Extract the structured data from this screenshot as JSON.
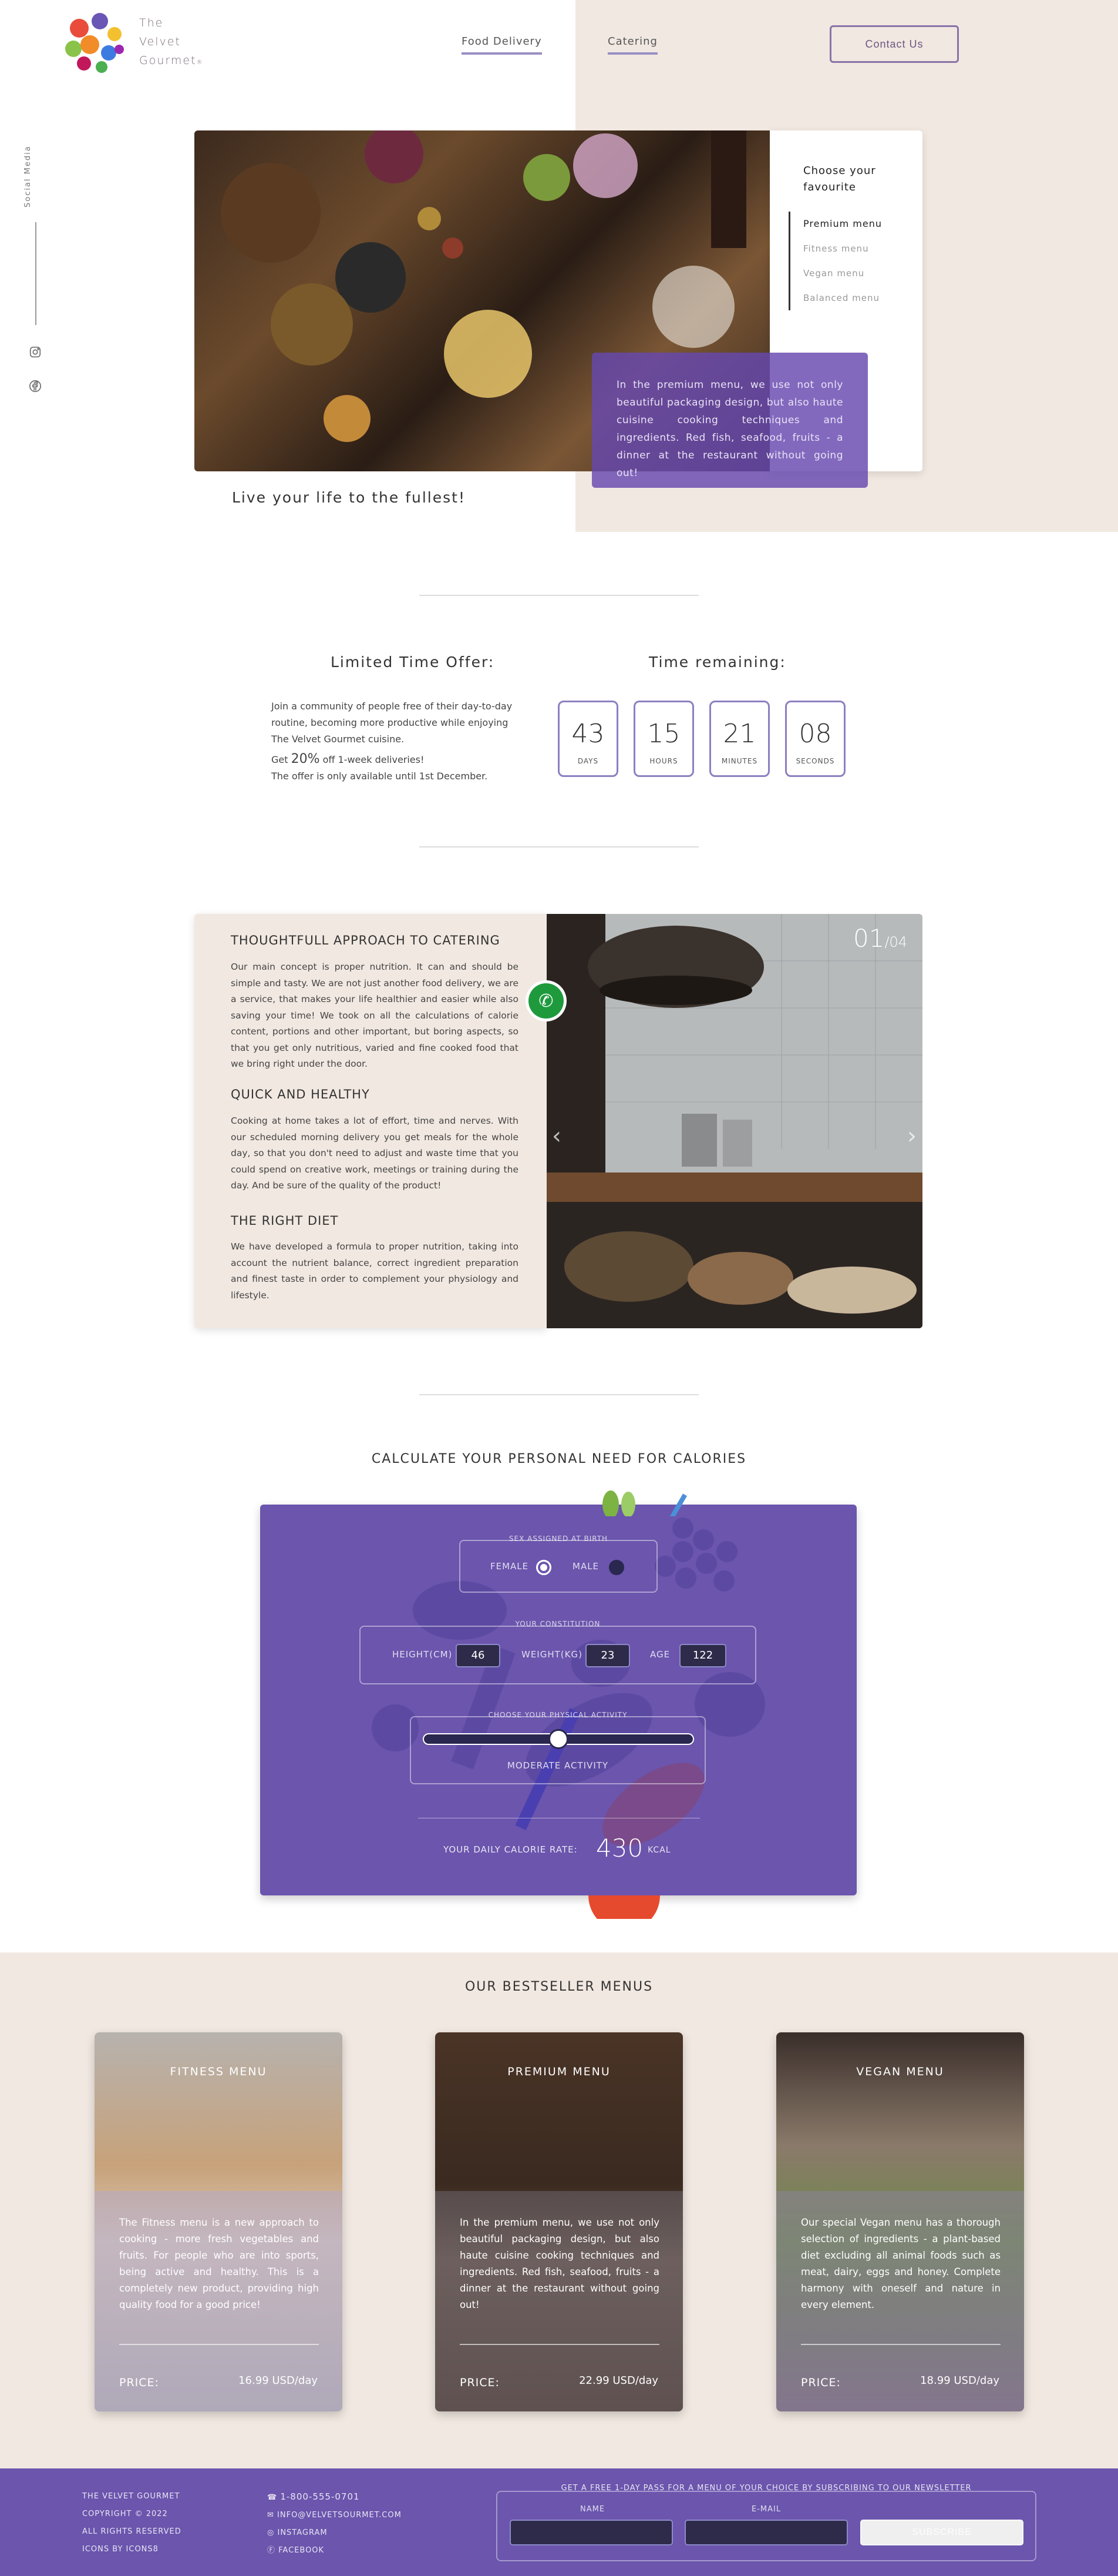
{
  "brand": {
    "name_lines": [
      "The",
      "Velvet",
      "Gourmet"
    ],
    "registered": "®"
  },
  "nav": {
    "links": [
      {
        "label": "Food Delivery"
      },
      {
        "label": "Catering"
      }
    ],
    "contact_label": "Contact Us"
  },
  "social": {
    "label": "Social Media",
    "icons": [
      "instagram-icon",
      "facebook-icon"
    ]
  },
  "hero": {
    "choose_title": "Choose your favourite",
    "menu_items": [
      {
        "label": "Premium menu",
        "active": true
      },
      {
        "label": "Fitness menu",
        "active": false
      },
      {
        "label": "Vegan menu",
        "active": false
      },
      {
        "label": "Balanced menu",
        "active": false
      }
    ],
    "description": "In the premium menu, we use not only beautiful packaging design, but also haute cuisine cooking techniques and ingredients. Red fish, seafood, fruits - a dinner at the restaurant without going out!",
    "tagline": "Live your life to the fullest!"
  },
  "offer": {
    "title": "Limited Time Offer:",
    "text": "Join a community of people free of their day-to-day routine, becoming more productive while enjoying The Velvet Gourmet cuisine.",
    "discount_prefix": "Get ",
    "discount_value": "20%",
    "discount_suffix": " off 1-week deliveries!",
    "availability": "The offer is only available until 1st December.",
    "countdown_title": "Time remaining:",
    "countdown": [
      {
        "value": "43",
        "label": "Days"
      },
      {
        "value": "15",
        "label": "Hours"
      },
      {
        "value": "21",
        "label": "Minutes"
      },
      {
        "value": "08",
        "label": "Seconds"
      }
    ]
  },
  "catering": {
    "sections": [
      {
        "title": "Thoughtfull approach to catering",
        "text": "Our main concept is proper nutrition. It can and should be simple and tasty. We are not just another food delivery, we are a service, that makes your life healthier and easier while also saving your time! We took on all the calculations of calorie content, portions and other important, but boring aspects, so that you get only nutritious, varied and fine cooked food that we bring right under the door."
      },
      {
        "title": "Quick and healthy",
        "text": "Cooking at home takes a lot of effort, time and nerves. With our scheduled morning delivery you get meals for the whole day, so that you don't need to adjust and waste time that you could spend on creative work, meetings or training during the day. And be sure of the quality of the product!"
      },
      {
        "title": "The right diet",
        "text": "We have developed a formula to proper nutrition, taking into account the nutrient balance, correct ingredient preparation and finest taste in order to complement your physiology and lifestyle."
      }
    ],
    "slide_current": "01",
    "slide_total": "/04"
  },
  "calculator": {
    "title": "Calculate your personal need for calories",
    "sex_legend": "Sex assigned at birth",
    "sex_options": [
      {
        "label": "Female",
        "selected": true
      },
      {
        "label": "Male",
        "selected": false
      }
    ],
    "constitution_legend": "Your constitution",
    "height_label": "Height(cm)",
    "height_value": "46",
    "weight_label": "Weight(kg)",
    "weight_value": "23",
    "age_label": "Age",
    "age_value": "122",
    "activity_legend": "Choose your physical activity",
    "activity_level": 0.5,
    "activity_label": "Moderate Activity",
    "rate_label": "Your daily calorie rate:",
    "rate_value": "430",
    "rate_unit": "kcal"
  },
  "bestsellers": {
    "title": "Our bestseller menus",
    "price_label": "Price:",
    "cards": [
      {
        "title": "Fitness menu",
        "text": "The Fitness menu is a new approach to cooking - more fresh vegetables and fruits. For people who are into sports, being active and healthy. This is a completely new product, providing high quality food for a good price!",
        "price": "16.99 USD/day"
      },
      {
        "title": "Premium menu",
        "text": "In the premium menu, we use not only beautiful packaging design, but also haute cuisine cooking techniques and ingredients. Red fish, seafood, fruits - a dinner at the restaurant without going out!",
        "price": "22.99 USD/day"
      },
      {
        "title": "Vegan menu",
        "text": "Our special Vegan menu has a thorough selection of ingredients - a plant-based diet excluding all animal foods such as meat, dairy, eggs and honey. Complete harmony with oneself and nature in every element.",
        "price": "18.99 USD/day"
      }
    ]
  },
  "footer": {
    "company": "The Velvet Gourmet",
    "copyright": "Copyright © 2022",
    "rights": "All rights reserved",
    "icons_credit": "Icons by Icons8",
    "phone": "1-800-555-0701",
    "email": "info@velvetsourmet.com",
    "instagram": "Instagram",
    "facebook": "Facebook",
    "newsletter_legend": "Get a free 1-day pass for a menu of your choice by subscribing to our newsletter",
    "name_label": "Name",
    "email_label": "E-mail",
    "name_value": "",
    "email_value": "",
    "subscribe_label": "Subscribe"
  }
}
